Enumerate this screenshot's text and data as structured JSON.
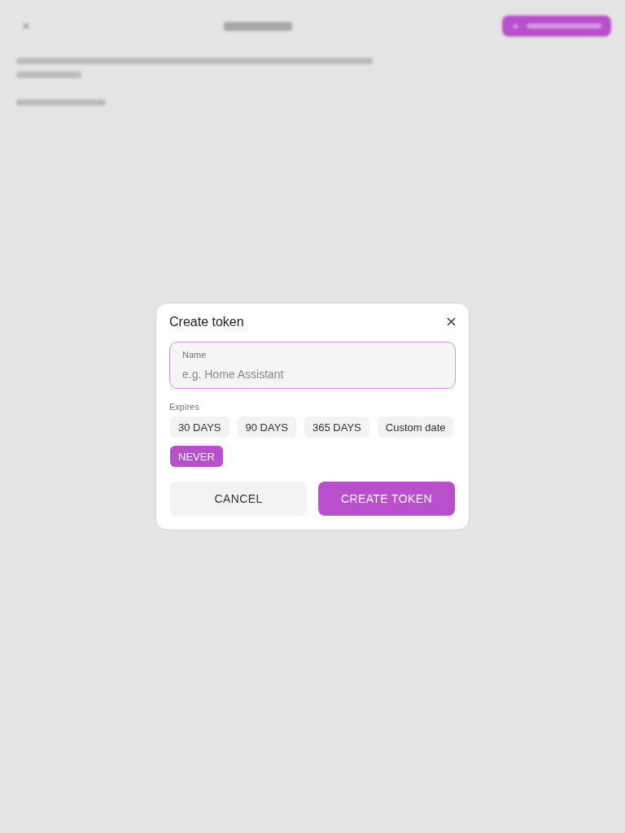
{
  "dialog": {
    "title": "Create token",
    "name_field": {
      "label": "Name",
      "placeholder": "e.g. Home Assistant"
    },
    "expires": {
      "label": "Expires",
      "options": [
        {
          "label": "30 DAYS",
          "selected": false
        },
        {
          "label": "90 DAYS",
          "selected": false
        },
        {
          "label": "365 DAYS",
          "selected": false
        },
        {
          "label": "Custom date",
          "selected": false
        },
        {
          "label": "NEVER",
          "selected": true
        }
      ]
    },
    "buttons": [
      {
        "label": "CANCEL",
        "kind": "secondary"
      },
      {
        "label": "CREATE TOKEN",
        "kind": "primary"
      }
    ]
  }
}
